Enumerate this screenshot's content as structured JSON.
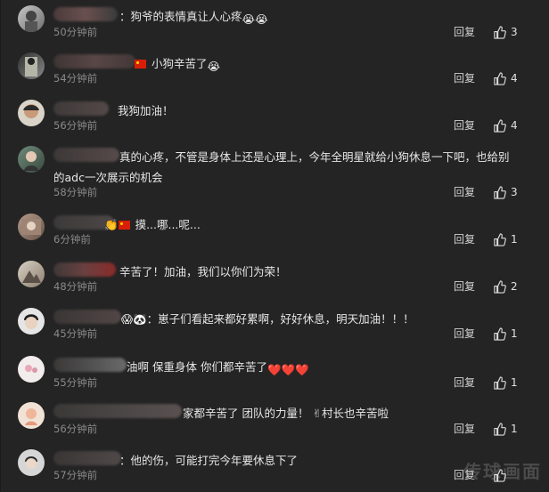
{
  "comments": [
    {
      "text": "：狗爷的表情真让人心疼",
      "emoji": "😭😭",
      "time": "50分钟前",
      "reply": "回复",
      "likes": "3"
    },
    {
      "text": "小狗辛苦了",
      "emoji": "😭",
      "time": "54分钟前",
      "reply": "回复",
      "likes": "4"
    },
    {
      "text": "我狗加油！",
      "time": "56分钟前",
      "reply": "回复",
      "likes": "4"
    },
    {
      "text": "真的心疼，不管是身体上还是心理上，今年全明星就给小狗休息一下吧，也给别的adc一次展示的机会",
      "time": "58分钟前",
      "reply": "回复",
      "likes": "3"
    },
    {
      "text": "摸...哪...呢...",
      "time": "6分钟前",
      "reply": "回复",
      "likes": "1"
    },
    {
      "text": "辛苦了！加油，我们以你们为荣！",
      "time": "48分钟前",
      "reply": "回复",
      "likes": "2"
    },
    {
      "text": "：崽子们看起来都好累啊，好好休息，明天加油！！！",
      "time": "45分钟前",
      "reply": "回复",
      "likes": "1"
    },
    {
      "text": "油啊 保重身体 你们都辛苦了",
      "emoji": "❤️❤️❤️",
      "time": "55分钟前",
      "reply": "回复",
      "likes": "1"
    },
    {
      "text": "家都辛苦了 团队的力量！",
      "text2": "村长也辛苦啦",
      "time": "56分钟前",
      "reply": "回复",
      "likes": "1"
    },
    {
      "text": "：他的伤，可能打完今年要休息下了",
      "time": "57分钟前",
      "reply": "回复",
      "likes": ""
    }
  ],
  "watermark": "传球画面",
  "colors": {
    "bg": "#242424",
    "text": "#e6e6e6",
    "time": "#8a8a8a"
  }
}
